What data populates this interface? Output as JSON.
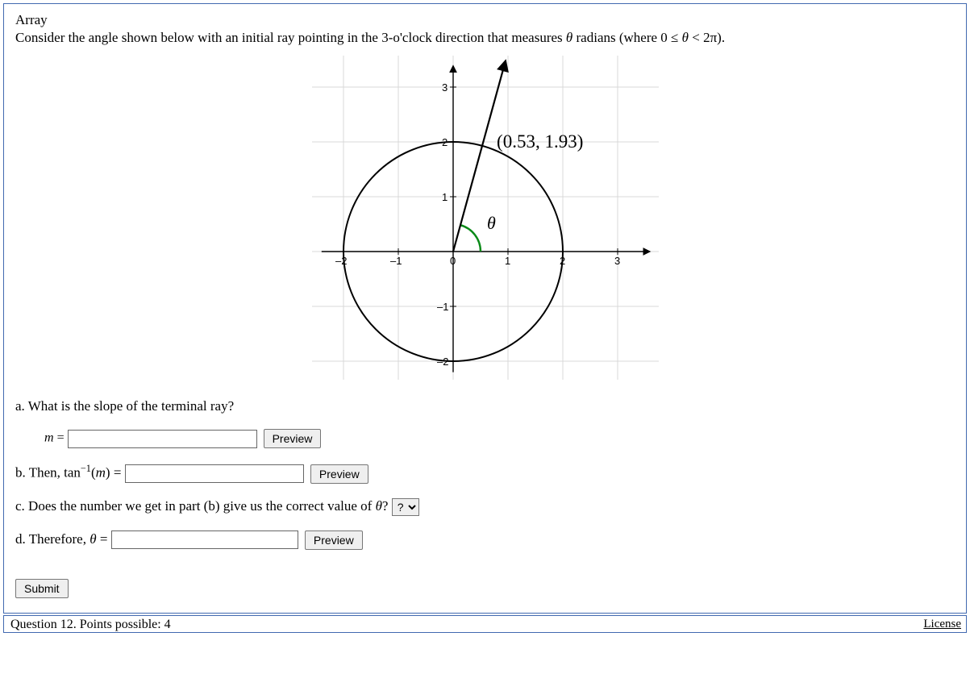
{
  "title": "Array",
  "prompt_pre": "Consider the angle shown below with an initial ray pointing in the 3-o'clock direction that measures ",
  "prompt_theta": "θ",
  "prompt_mid": " radians (where 0 ≤ ",
  "prompt_post": " < 2π).",
  "graph": {
    "xmin": -2.4,
    "xmax": 3.5,
    "ymin": -2.2,
    "ymax": 3.3,
    "ticks_x": [
      "-2",
      "-1",
      "0",
      "1",
      "2",
      "3"
    ],
    "ticks_y_pos": [
      "1",
      "2",
      "3"
    ],
    "ticks_y_neg": [
      "-1",
      "-2"
    ],
    "circle_radius": 2,
    "point_label": "(0.53, 1.93)",
    "theta_label": "θ",
    "terminal_x": 0.53,
    "terminal_y": 1.93
  },
  "parts": {
    "a": {
      "text": "a. What is the slope of the terminal ray?",
      "label_pre": "m",
      "eq": " = "
    },
    "b": {
      "pre": "b. Then, tan",
      "exp": "−1",
      "arg": "(m)",
      "eq": " = "
    },
    "c": {
      "pre": "c. Does the number we get in part (b) give us the correct value of ",
      "theta": "θ",
      "post": "? "
    },
    "d": {
      "pre": "d. Therefore, ",
      "theta": "θ",
      "eq": " = "
    }
  },
  "select_default": "?",
  "buttons": {
    "preview": "Preview",
    "submit": "Submit"
  },
  "footer": {
    "left": "Question 12. Points possible: 4",
    "license": "License"
  }
}
